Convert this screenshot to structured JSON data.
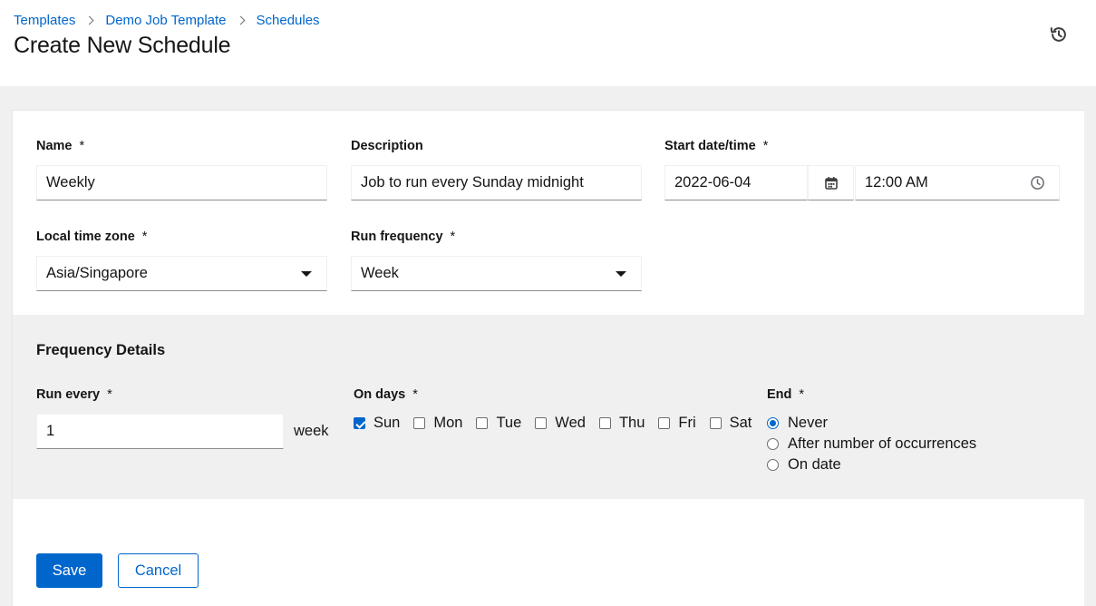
{
  "breadcrumb": {
    "items": [
      "Templates",
      "Demo Job Template",
      "Schedules"
    ]
  },
  "page": {
    "title": "Create New Schedule"
  },
  "form": {
    "required_marker": "*",
    "name": {
      "label": "Name",
      "value": "Weekly"
    },
    "description": {
      "label": "Description",
      "value": "Job to run every Sunday midnight"
    },
    "start": {
      "label": "Start date/time",
      "date": "2022-06-04",
      "time": "12:00 AM"
    },
    "timezone": {
      "label": "Local time zone",
      "value": "Asia/Singapore"
    },
    "frequency": {
      "label": "Run frequency",
      "value": "Week"
    }
  },
  "frequency_details": {
    "title": "Frequency Details",
    "run_every": {
      "label": "Run every",
      "value": "1",
      "unit": "week"
    },
    "on_days": {
      "label": "On days",
      "days": [
        {
          "label": "Sun",
          "checked": true
        },
        {
          "label": "Mon",
          "checked": false
        },
        {
          "label": "Tue",
          "checked": false
        },
        {
          "label": "Wed",
          "checked": false
        },
        {
          "label": "Thu",
          "checked": false
        },
        {
          "label": "Fri",
          "checked": false
        },
        {
          "label": "Sat",
          "checked": false
        }
      ]
    },
    "end": {
      "label": "End",
      "options": [
        {
          "label": "Never",
          "selected": true
        },
        {
          "label": "After number of occurrences",
          "selected": false
        },
        {
          "label": "On date",
          "selected": false
        }
      ]
    }
  },
  "actions": {
    "save_label": "Save",
    "cancel_label": "Cancel"
  },
  "icons": {
    "history": "history-icon",
    "calendar": "calendar-icon",
    "clock": "clock-icon",
    "caret": "caret-down-icon"
  },
  "colors": {
    "accent": "#0066cc",
    "text": "#151515",
    "background": "#f0f0f0"
  }
}
